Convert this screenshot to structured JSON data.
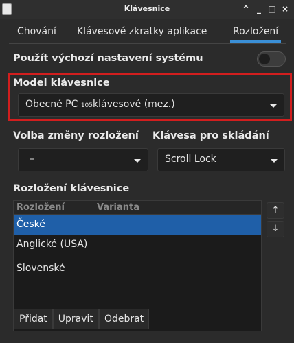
{
  "window": {
    "title": "Klávesnice",
    "app_icon_glyph": "keyboard"
  },
  "tabs": [
    {
      "label": "Chování"
    },
    {
      "label": "Klávesové zkratky aplikace"
    },
    {
      "label": "Rozložení",
      "active": true
    }
  ],
  "system_default": {
    "label": "Použít výchozí nastavení systému",
    "enabled": false
  },
  "model": {
    "label": "Model klávesnice",
    "value_prefix": "Obecné PC ",
    "value_small": "105",
    "value_suffix": "klávesové (mez.)"
  },
  "layout_change": {
    "label": "Volba změny rozložení",
    "value": "–"
  },
  "compose_key": {
    "label": "Klávesa pro skládání",
    "value": "Scroll Lock"
  },
  "layouts": {
    "label": "Rozložení klávesnice",
    "columns": [
      "Rozložení",
      "Varianta"
    ],
    "rows": [
      {
        "name": "České",
        "selected": true
      },
      {
        "name": "Anglické (USA)"
      },
      {
        "name": "Slovenské"
      }
    ]
  },
  "buttons": {
    "add": "Přidat",
    "edit": "Upravit",
    "remove": "Odebrat"
  },
  "colors": {
    "accent": "#3a8fd6",
    "selection": "#1f5fa8",
    "highlight_box": "#d21e1e"
  }
}
